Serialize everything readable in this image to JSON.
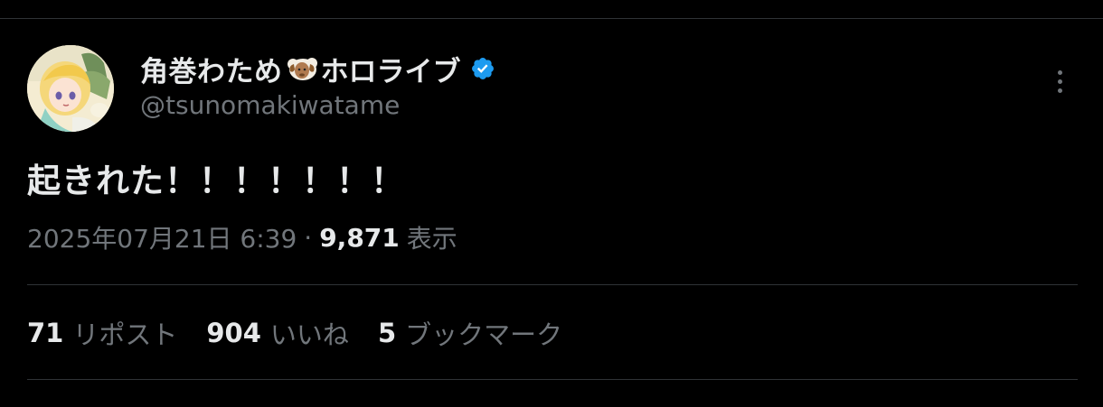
{
  "author": {
    "display_name": "角巻わため",
    "name_emoji": "sheep-emoji",
    "name_suffix": "ホロライブ",
    "handle": "@tsunomakiwatame",
    "verified_color": "#1d9bf0"
  },
  "tweet": {
    "text": "起きれた！！！！！！！",
    "timestamp": "2025年07月21日 6:39",
    "separator": "·",
    "views_count": "9,871",
    "views_label": "表示"
  },
  "stats": {
    "reposts_count": "71",
    "reposts_label": "リポスト",
    "likes_count": "904",
    "likes_label": "いいね",
    "bookmarks_count": "5",
    "bookmarks_label": "ブックマーク"
  },
  "colors": {
    "background": "#000000",
    "primary_text": "#e7e9ea",
    "secondary_text": "#71767b",
    "divider": "#2f3336"
  }
}
